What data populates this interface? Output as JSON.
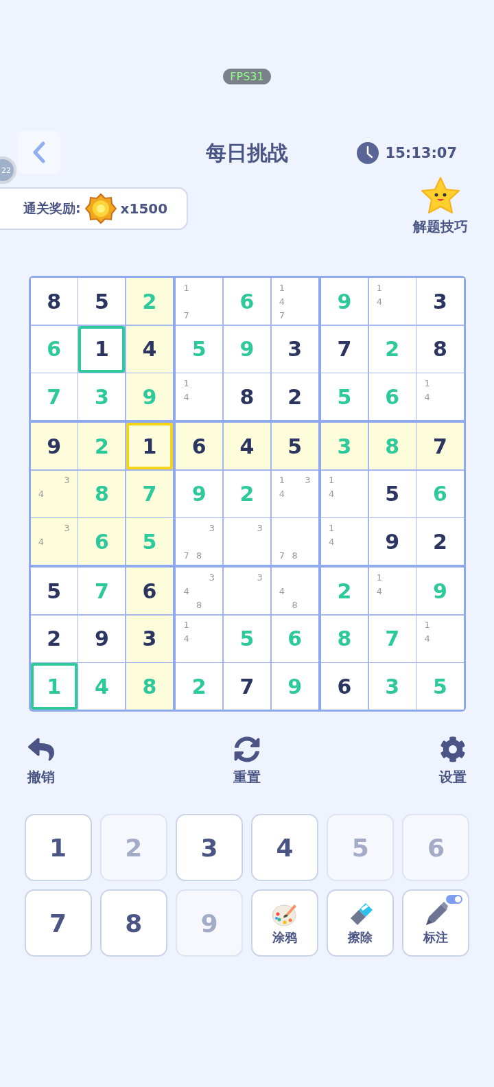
{
  "fps_badge": "FPS31",
  "side_badge": "22",
  "header": {
    "title": "每日挑战",
    "time": "15:13:07"
  },
  "reward": {
    "label": "通关奖励:",
    "amount": "x1500"
  },
  "tips": {
    "label": "解题技巧"
  },
  "board": {
    "rows": [
      [
        {
          "v": "8",
          "kind": "given",
          "selected": false
        },
        {
          "v": "5",
          "kind": "given",
          "selected": false
        },
        {
          "v": "2",
          "kind": "entered",
          "selected": false
        },
        {
          "notes": [
            "1",
            "7"
          ],
          "selected": false
        },
        {
          "v": "6",
          "kind": "entered",
          "selected": false
        },
        {
          "notes": [
            "1",
            "4",
            "7"
          ],
          "selected": false
        },
        {
          "v": "9",
          "kind": "entered",
          "selected": false
        },
        {
          "notes": [
            "1",
            "4"
          ],
          "selected": false
        },
        {
          "v": "3",
          "kind": "given",
          "selected": false
        }
      ],
      [
        {
          "v": "6",
          "kind": "entered",
          "selected": false
        },
        {
          "v": "1",
          "kind": "given",
          "outlined": true,
          "selected": false
        },
        {
          "v": "4",
          "kind": "given",
          "selected": false
        },
        {
          "v": "5",
          "kind": "entered",
          "selected": false
        },
        {
          "v": "9",
          "kind": "entered",
          "selected": false
        },
        {
          "v": "3",
          "kind": "given",
          "selected": false
        },
        {
          "v": "7",
          "kind": "given",
          "selected": false
        },
        {
          "v": "2",
          "kind": "entered",
          "selected": false
        },
        {
          "v": "8",
          "kind": "given",
          "selected": false
        }
      ],
      [
        {
          "v": "7",
          "kind": "entered",
          "selected": false
        },
        {
          "v": "3",
          "kind": "entered",
          "selected": false
        },
        {
          "v": "9",
          "kind": "entered",
          "selected": false
        },
        {
          "notes": [
            "1",
            "4"
          ],
          "selected": false
        },
        {
          "v": "8",
          "kind": "given",
          "selected": false
        },
        {
          "v": "2",
          "kind": "given",
          "selected": false
        },
        {
          "v": "5",
          "kind": "entered",
          "selected": false
        },
        {
          "v": "6",
          "kind": "entered",
          "selected": false
        },
        {
          "notes": [
            "1",
            "4"
          ],
          "selected": false
        }
      ],
      [
        {
          "v": "9",
          "kind": "given",
          "selected": false
        },
        {
          "v": "2",
          "kind": "entered",
          "selected": false
        },
        {
          "v": "1",
          "kind": "given",
          "selected": true
        },
        {
          "v": "6",
          "kind": "given",
          "selected": false
        },
        {
          "v": "4",
          "kind": "given",
          "selected": false
        },
        {
          "v": "5",
          "kind": "given",
          "selected": false
        },
        {
          "v": "3",
          "kind": "entered",
          "selected": false
        },
        {
          "v": "8",
          "kind": "entered",
          "selected": false
        },
        {
          "v": "7",
          "kind": "given",
          "selected": false
        }
      ],
      [
        {
          "notes": [
            "3",
            "4"
          ],
          "selected": false
        },
        {
          "v": "8",
          "kind": "entered",
          "selected": false
        },
        {
          "v": "7",
          "kind": "entered",
          "selected": false
        },
        {
          "v": "9",
          "kind": "entered",
          "selected": false
        },
        {
          "v": "2",
          "kind": "entered",
          "selected": false
        },
        {
          "notes": [
            "1",
            "3",
            "4"
          ],
          "selected": false
        },
        {
          "notes": [
            "1",
            "4"
          ],
          "selected": false
        },
        {
          "v": "5",
          "kind": "given",
          "selected": false
        },
        {
          "v": "6",
          "kind": "entered",
          "selected": false
        }
      ],
      [
        {
          "notes": [
            "3",
            "4"
          ],
          "selected": false
        },
        {
          "v": "6",
          "kind": "entered",
          "selected": false
        },
        {
          "v": "5",
          "kind": "entered",
          "selected": false
        },
        {
          "notes": [
            "3",
            "7",
            "8"
          ],
          "selected": false
        },
        {
          "notes": [
            "3"
          ],
          "selected": false
        },
        {
          "notes": [
            "7",
            "8"
          ],
          "selected": false
        },
        {
          "notes": [
            "1",
            "4"
          ],
          "selected": false
        },
        {
          "v": "9",
          "kind": "given",
          "selected": false
        },
        {
          "v": "2",
          "kind": "given",
          "selected": false
        }
      ],
      [
        {
          "v": "5",
          "kind": "given",
          "selected": false
        },
        {
          "v": "7",
          "kind": "entered",
          "selected": false
        },
        {
          "v": "6",
          "kind": "given",
          "selected": false
        },
        {
          "notes": [
            "3",
            "4",
            "8"
          ],
          "selected": false
        },
        {
          "notes": [
            "3"
          ],
          "selected": false
        },
        {
          "notes": [
            "4",
            "8"
          ],
          "selected": false
        },
        {
          "v": "2",
          "kind": "entered",
          "selected": false
        },
        {
          "notes": [
            "1",
            "4"
          ],
          "selected": false
        },
        {
          "v": "9",
          "kind": "entered",
          "selected": false
        }
      ],
      [
        {
          "v": "2",
          "kind": "given",
          "selected": false
        },
        {
          "v": "9",
          "kind": "given",
          "selected": false
        },
        {
          "v": "3",
          "kind": "given",
          "selected": false
        },
        {
          "notes": [
            "1",
            "4"
          ],
          "selected": false
        },
        {
          "v": "5",
          "kind": "entered",
          "selected": false
        },
        {
          "v": "6",
          "kind": "entered",
          "selected": false
        },
        {
          "v": "8",
          "kind": "entered",
          "selected": false
        },
        {
          "v": "7",
          "kind": "entered",
          "selected": false
        },
        {
          "notes": [
            "1",
            "4"
          ],
          "selected": false
        }
      ],
      [
        {
          "v": "1",
          "kind": "entered",
          "outlined": true,
          "selected": false
        },
        {
          "v": "4",
          "kind": "entered",
          "selected": false
        },
        {
          "v": "8",
          "kind": "entered",
          "selected": false
        },
        {
          "v": "2",
          "kind": "entered",
          "selected": false
        },
        {
          "v": "7",
          "kind": "given",
          "selected": false
        },
        {
          "v": "9",
          "kind": "entered",
          "selected": false
        },
        {
          "v": "6",
          "kind": "given",
          "selected": false
        },
        {
          "v": "3",
          "kind": "entered",
          "selected": false
        },
        {
          "v": "5",
          "kind": "entered",
          "selected": false
        }
      ]
    ]
  },
  "actions": [
    {
      "kind": "undo",
      "label": "撤销"
    },
    {
      "kind": "reset",
      "label": "重置"
    },
    {
      "kind": "settings",
      "label": "设置"
    }
  ],
  "keypad": [
    {
      "kind": "number",
      "label": "1",
      "disabled": false
    },
    {
      "kind": "number",
      "label": "2",
      "disabled": true
    },
    {
      "kind": "number",
      "label": "3",
      "disabled": false
    },
    {
      "kind": "number",
      "label": "4",
      "disabled": false
    },
    {
      "kind": "number",
      "label": "5",
      "disabled": true
    },
    {
      "kind": "number",
      "label": "6",
      "disabled": true
    },
    {
      "kind": "number",
      "label": "7",
      "disabled": false
    },
    {
      "kind": "number",
      "label": "8",
      "disabled": false
    },
    {
      "kind": "number",
      "label": "9",
      "disabled": true
    },
    {
      "kind": "doodle",
      "label": "涂鸦"
    },
    {
      "kind": "erase",
      "label": "擦除"
    },
    {
      "kind": "note",
      "label": "标注",
      "on": true
    }
  ]
}
